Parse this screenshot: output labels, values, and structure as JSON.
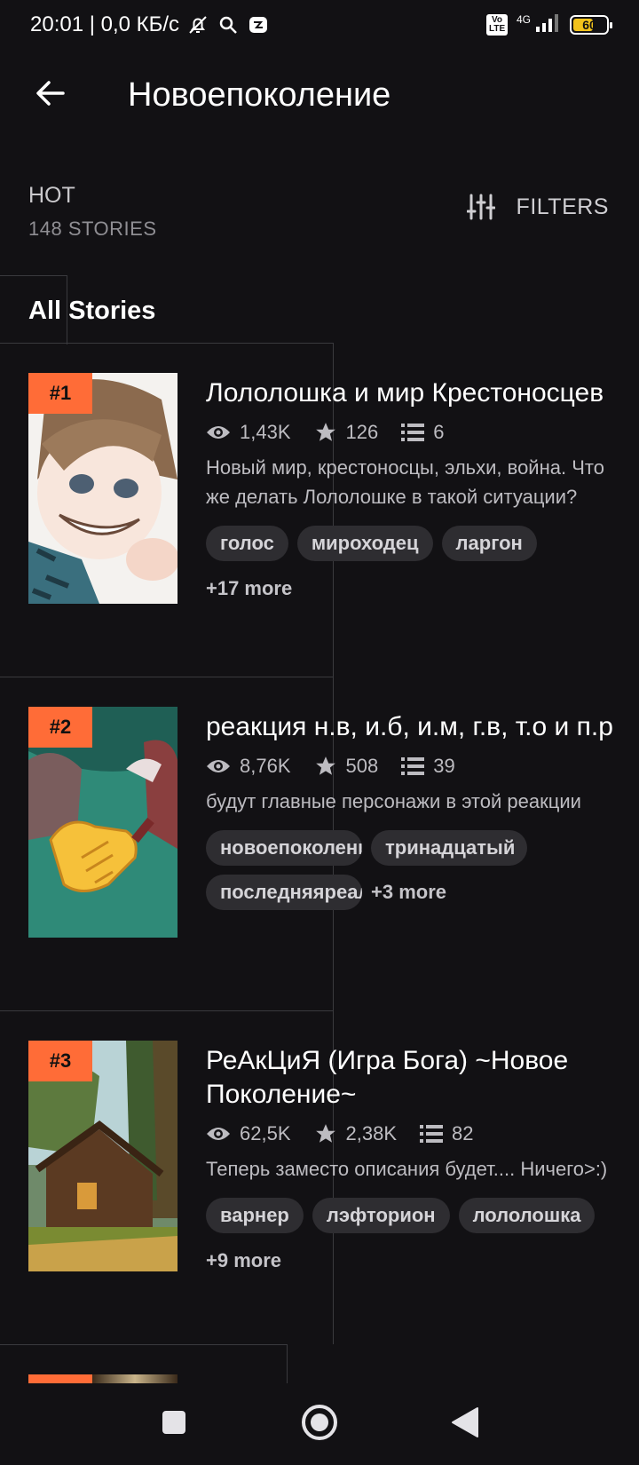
{
  "status_bar": {
    "time": "20:01 | 0,0 КБ/с",
    "volte": "Vo LTE",
    "network": "4G",
    "battery": "60",
    "battery_level": 0.6
  },
  "app_bar": {
    "back_icon": "arrow-left-icon",
    "title": "Новоепоколение"
  },
  "section": {
    "label": "HOT",
    "count": "148 STORIES",
    "filters_label": "FILTERS",
    "tab": "All Stories"
  },
  "colors": {
    "background": "#121114",
    "rank_badge": "#ff6c37",
    "tag_bg": "#2e2d31"
  },
  "stories": [
    {
      "rank": "#1",
      "title": "Лололошка и мир Крестоносцев",
      "reads": "1,43K",
      "votes": "126",
      "parts": "6",
      "description": "Новый мир, крестоносцы, эльхи, война. Что же делать Лололошке в такой ситуации?",
      "tags": [
        "голос",
        "мироходец",
        "ларгон"
      ],
      "more": "+17 more"
    },
    {
      "rank": "#2",
      "title": "реакция н.в, и.б, и.м, г.в, т.о и п.р",
      "reads": "8,76K",
      "votes": "508",
      "parts": "39",
      "description": "будут главные персонажи в этой реакции",
      "tags": [
        "новоепоколение",
        "тринадцатый",
        "последняяреальность"
      ],
      "more": "+3 more"
    },
    {
      "rank": "#3",
      "title": "РеАкЦиЯ (Игра Бога) ~Новое Поколение~",
      "reads": "62,5K",
      "votes": "2,38K",
      "parts": "82",
      "description": "Теперь заместо описания будет.... Ничего>:)",
      "tags": [
        "варнер",
        "лэфторион",
        "лололошка"
      ],
      "more": "+9 more"
    }
  ]
}
